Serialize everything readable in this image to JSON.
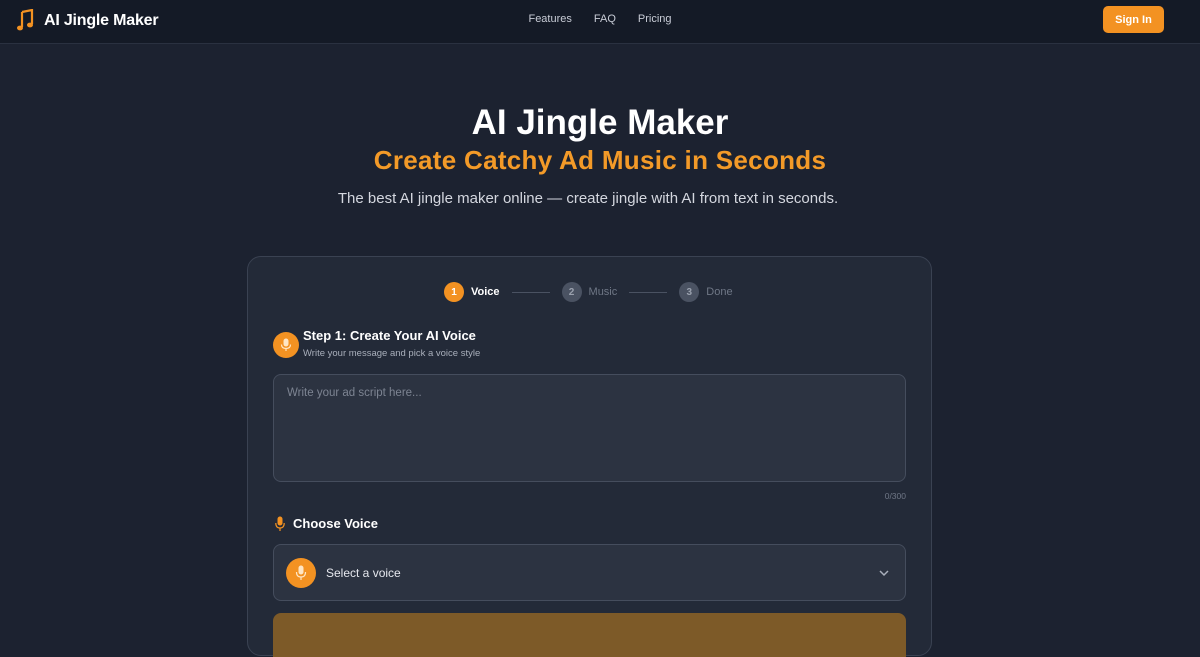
{
  "nav": {
    "brand": "AI Jingle Maker",
    "links": [
      "Features",
      "FAQ",
      "Pricing"
    ],
    "signin": "Sign In"
  },
  "hero": {
    "title": "AI Jingle Maker",
    "subtitle": "Create Catchy Ad Music in Seconds",
    "description": "The best AI jingle maker online — create jingle with AI from text in seconds."
  },
  "stepper": [
    {
      "number": "1",
      "label": "Voice",
      "state": "active"
    },
    {
      "number": "2",
      "label": "Music",
      "state": "inactive"
    },
    {
      "number": "3",
      "label": "Done",
      "state": "inactive"
    }
  ],
  "step1": {
    "title": "Step 1: Create Your AI Voice",
    "subtitle": "Write your message and pick a voice style",
    "script_placeholder": "Write your ad script here...",
    "script_value": "",
    "char_count": "0/300"
  },
  "voice": {
    "label": "Choose Voice",
    "select_text": "Select a voice"
  },
  "icons": {
    "logo": "music-note-icon",
    "section": "microphone-icon",
    "voice_label": "microphone-icon",
    "voice_select": "microphone-icon",
    "dropdown": "chevron-down-icon"
  },
  "colors": {
    "accent": "#f39222",
    "subtitle": "#f39a28",
    "background": "#1c2230",
    "navbar": "#141a26",
    "card": "#232a38"
  }
}
